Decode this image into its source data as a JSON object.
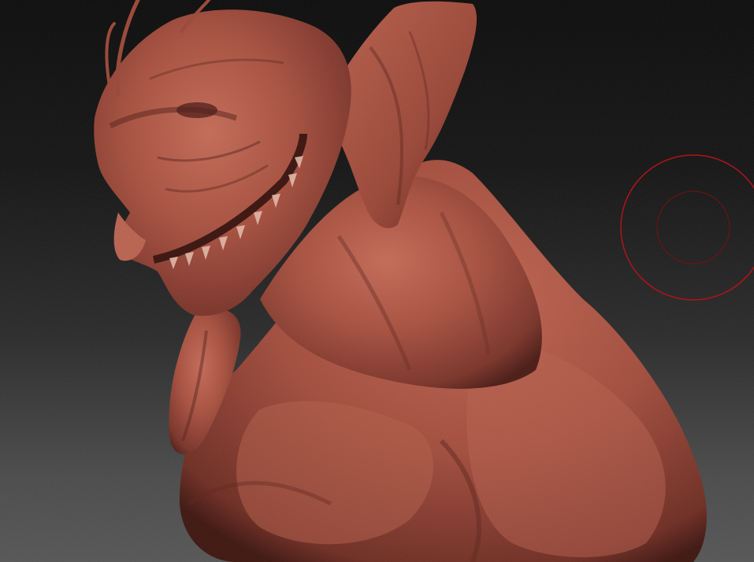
{
  "viewport": {
    "background_top": "#0b0b0b",
    "background_bottom": "#555555"
  },
  "model": {
    "material_color": "#a8503f",
    "shadow_color": "#4a1a14",
    "highlight_color": "#d07a68"
  },
  "brush_cursor": {
    "icon": "brush-cursor-icon",
    "color": "#b0141a"
  }
}
